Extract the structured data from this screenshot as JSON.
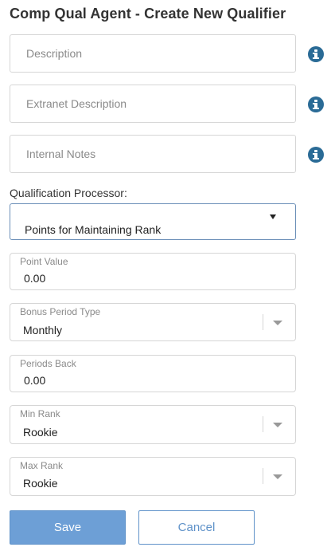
{
  "header": {
    "title": "Comp Qual Agent - Create New Qualifier"
  },
  "fields": {
    "description": {
      "placeholder": "Description",
      "info_icon": "info-icon"
    },
    "extranet_description": {
      "placeholder": "Extranet Description",
      "info_icon": "info-icon"
    },
    "internal_notes": {
      "placeholder": "Internal Notes",
      "info_icon": "info-icon"
    }
  },
  "qualification_processor": {
    "label": "Qualification Processor:",
    "value": "Points for Maintaining Rank"
  },
  "point_value": {
    "label": "Point Value",
    "value": "0.00"
  },
  "bonus_period_type": {
    "label": "Bonus Period Type",
    "value": "Monthly"
  },
  "periods_back": {
    "label": "Periods Back",
    "value": "0.00"
  },
  "min_rank": {
    "label": "Min Rank",
    "value": "Rookie"
  },
  "max_rank": {
    "label": "Max Rank",
    "value": "Rookie"
  },
  "actions": {
    "save_label": "Save",
    "cancel_label": "Cancel"
  },
  "colors": {
    "info_icon": "#2a6b96",
    "primary_button": "#6d9fd6",
    "focus_border": "#6b8fb8"
  }
}
